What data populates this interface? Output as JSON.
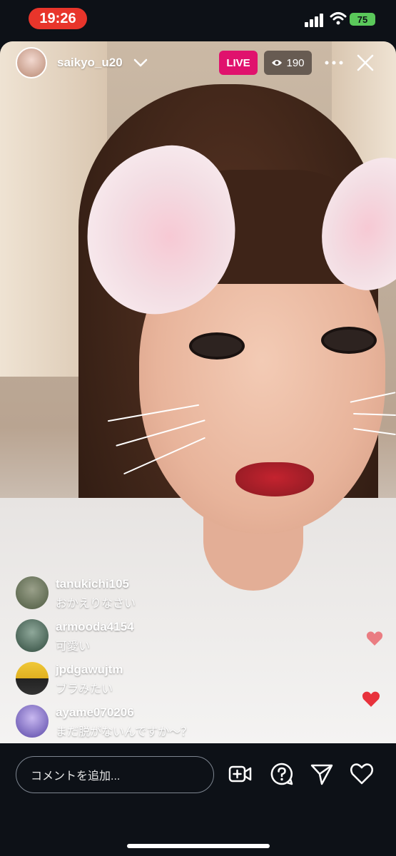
{
  "status_bar": {
    "time": "19:26",
    "battery": "75"
  },
  "host": {
    "username": "saikyo_u20"
  },
  "live_label": "LIVE",
  "viewer_count": "190",
  "comments": [
    {
      "user": "tanukichi105",
      "text": "おかえりなさい",
      "avatar_color": "#6b7a5a"
    },
    {
      "user": "armooda4154",
      "text": "可愛い",
      "avatar_color": "#4a6b5a"
    },
    {
      "user": "jpdgawujtm",
      "text": "ブラみたい",
      "avatar_color": "#e0b830"
    },
    {
      "user": "ayame070206",
      "text": "まだ脱がないんですか〜？",
      "avatar_color": "#7a6bc8"
    }
  ],
  "comment_input": {
    "placeholder": "コメントを追加..."
  },
  "colors": {
    "live": "#e0126d",
    "time_pill": "#e8352b",
    "heart": "#e8323c",
    "background": "#0d1117"
  },
  "icons": [
    "video-add-icon",
    "question-icon",
    "send-icon",
    "heart-icon"
  ]
}
